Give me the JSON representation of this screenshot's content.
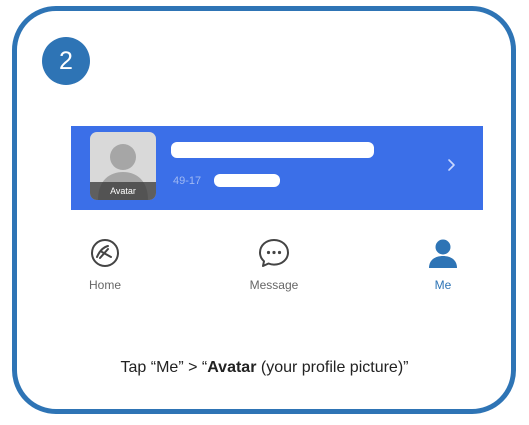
{
  "step": {
    "number": "2"
  },
  "profile": {
    "account_id_prefix": "49-17",
    "avatar_label": "Avatar",
    "chevron_icon": "chevron-right-icon"
  },
  "nav": {
    "tabs": [
      {
        "label": "Home",
        "icon": "home-icon",
        "active": false
      },
      {
        "label": "Message",
        "icon": "message-icon",
        "active": false
      },
      {
        "label": "Me",
        "icon": "user-icon",
        "active": true
      }
    ]
  },
  "instruction": {
    "prefix": "Tap “Me” > “",
    "bold": "Avatar",
    "suffix": " (your profile  picture)”"
  },
  "colors": {
    "accent": "#2e74b5",
    "banner": "#3b6fe8",
    "active_tab": "#2e74b5"
  }
}
